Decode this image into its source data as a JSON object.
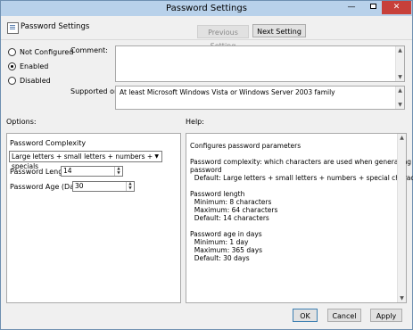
{
  "window": {
    "title": "Password Settings",
    "minimize_glyph": "—",
    "close_glyph": "✕"
  },
  "header": {
    "icon": "policy-settings-icon",
    "title": "Password Settings"
  },
  "nav": {
    "previous_label": "Previous Setting",
    "next_label": "Next Setting"
  },
  "state": {
    "options": [
      {
        "label": "Not Configured",
        "checked": false
      },
      {
        "label": "Enabled",
        "checked": true
      },
      {
        "label": "Disabled",
        "checked": false
      }
    ]
  },
  "comment": {
    "label": "Comment:",
    "value": ""
  },
  "supported": {
    "label": "Supported on:",
    "value": "At least Microsoft Windows Vista or Windows Server 2003 family"
  },
  "options_section": {
    "label": "Options:"
  },
  "help_section": {
    "label": "Help:"
  },
  "password_options": {
    "complexity_label": "Password Complexity",
    "complexity_value": "Large letters + small letters + numbers + specials",
    "length_label": "Password Length",
    "length_value": "14",
    "age_label": "Password Age (Days)",
    "age_value": "30"
  },
  "help_text": [
    "Configures password parameters",
    "",
    "Password complexity: which characters are used when generating a new",
    "password",
    "  Default: Large letters + small letters + numbers + special characters",
    "",
    "Password length",
    "  Minimum: 8 characters",
    "  Maximum: 64 characters",
    "  Default: 14 characters",
    "",
    "Password age in days",
    "  Minimum: 1 day",
    "  Maximum: 365 days",
    "  Default: 30 days"
  ],
  "footer": {
    "ok_label": "OK",
    "cancel_label": "Cancel",
    "apply_label": "Apply"
  },
  "colors": {
    "titlebar": "#b8d1ea",
    "close": "#c7403a",
    "background": "#f0f0f0"
  }
}
